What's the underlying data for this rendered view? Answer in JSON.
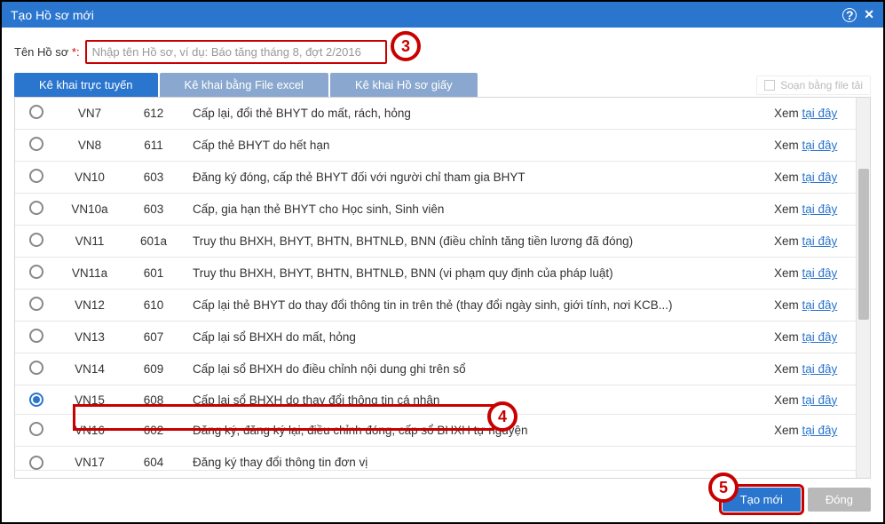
{
  "dialog": {
    "title": "Tạo Hồ sơ mới"
  },
  "name_field": {
    "label": "Tên Hồ sơ ",
    "star": "*:",
    "placeholder": "Nhập tên Hồ sơ, ví dụ: Báo tăng tháng 8, đợt 2/2016"
  },
  "tabs": {
    "t1": "Kê khai trực tuyến",
    "t2": "Kê khai bằng File excel",
    "t3": "Kê khai Hồ sơ giấy"
  },
  "type_hint": "Soạn bằng file tải",
  "rows": [
    {
      "code": "VN7",
      "num": "612",
      "desc": "Cấp lại, đổi thẻ BHYT do mất, rách, hỏng",
      "selected": false
    },
    {
      "code": "VN8",
      "num": "611",
      "desc": "Cấp thẻ BHYT do hết hạn",
      "selected": false
    },
    {
      "code": "VN10",
      "num": "603",
      "desc": "Đăng ký đóng, cấp thẻ BHYT đối với người chỉ tham gia BHYT",
      "selected": false
    },
    {
      "code": "VN10a",
      "num": "603",
      "desc": "Cấp, gia hạn thẻ BHYT cho Học sinh, Sinh viên",
      "selected": false
    },
    {
      "code": "VN11",
      "num": "601a",
      "desc": "Truy thu BHXH, BHYT, BHTN, BHTNLĐ, BNN (điều chỉnh tăng tiền lương đã đóng)",
      "selected": false
    },
    {
      "code": "VN11a",
      "num": "601",
      "desc": "Truy thu BHXH, BHYT, BHTN, BHTNLĐ, BNN (vi phạm quy định của pháp luật)",
      "selected": false
    },
    {
      "code": "VN12",
      "num": "610",
      "desc": "Cấp lại thẻ BHYT do thay đổi thông tin in trên thẻ (thay đổi ngày sinh, giới tính, nơi KCB...)",
      "selected": false
    },
    {
      "code": "VN13",
      "num": "607",
      "desc": "Cấp lại sổ BHXH do mất, hỏng",
      "selected": false
    },
    {
      "code": "VN14",
      "num": "609",
      "desc": "Cấp lại sổ BHXH do điều chỉnh nội dung ghi trên sổ",
      "selected": false
    },
    {
      "code": "VN15",
      "num": "608",
      "desc": "Cấp lại sổ BHXH do thay đổi thông tin cá nhân",
      "selected": true
    },
    {
      "code": "VN16",
      "num": "602",
      "desc": "Đăng ký, đăng ký lại, điều chỉnh đóng, cấp sổ BHXH tự nguyện",
      "selected": false
    }
  ],
  "truncated_row": {
    "code": "VN17",
    "num": "604",
    "desc": "Đăng ký thay đổi thông tin đơn vị"
  },
  "link": {
    "xem": "Xem ",
    "taiday": "tại đây"
  },
  "steps": {
    "s3": "3",
    "s4": "4",
    "s5": "5"
  },
  "buttons": {
    "create": "Tạo mới",
    "close": "Đóng"
  }
}
